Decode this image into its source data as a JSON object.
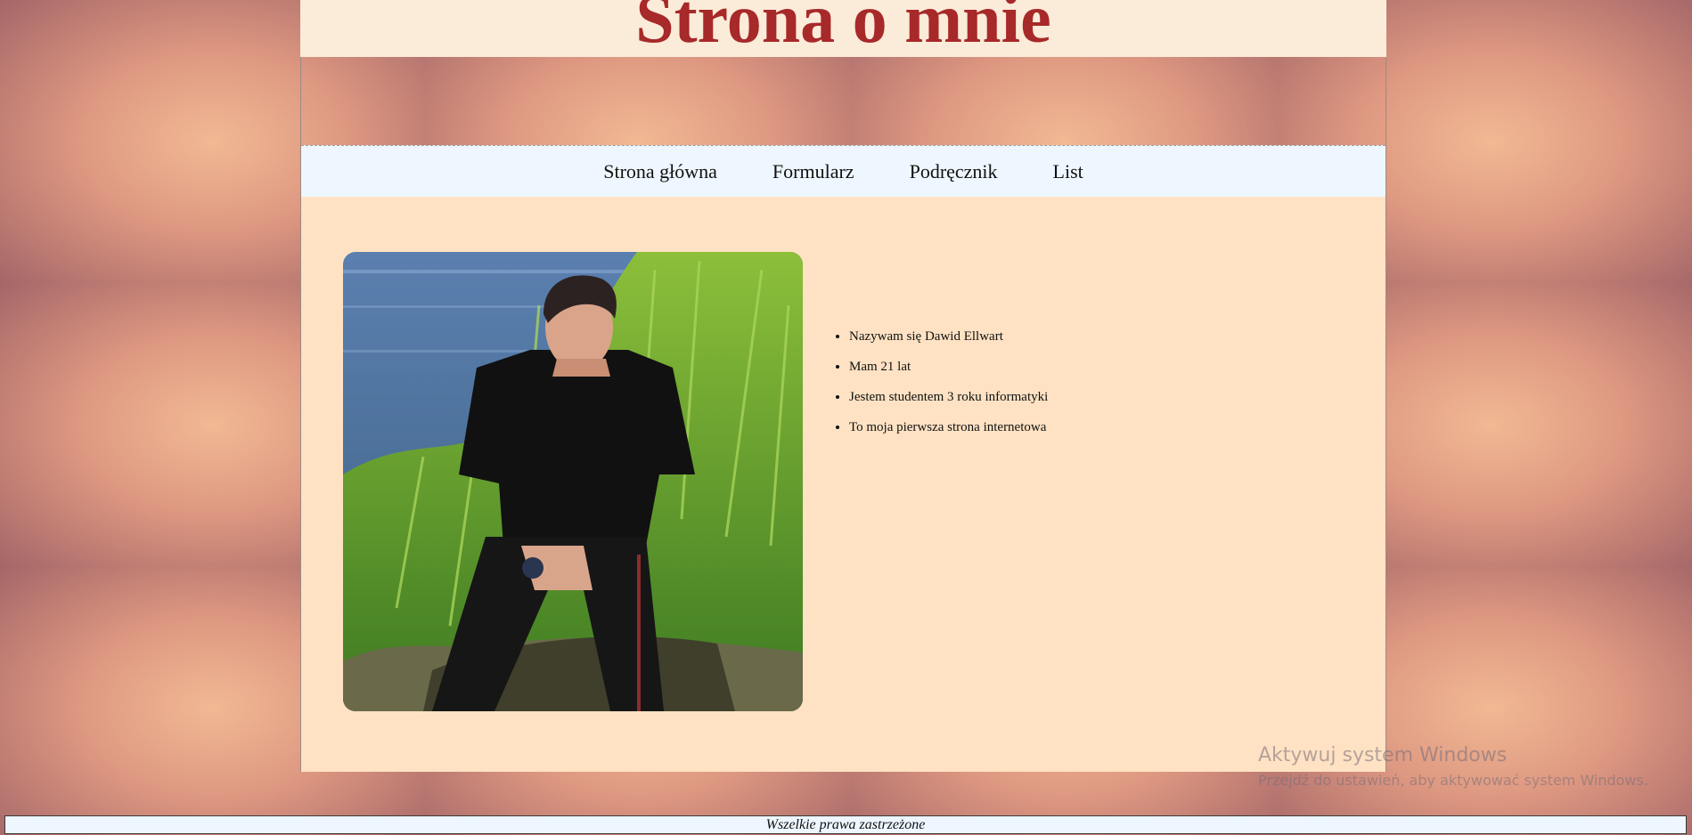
{
  "header": {
    "title": "Strona o mnie"
  },
  "nav": {
    "items": [
      {
        "label": "Strona główna"
      },
      {
        "label": "Formularz"
      },
      {
        "label": "Podręcznik"
      },
      {
        "label": "List"
      }
    ]
  },
  "profile": {
    "photo_alt": "photo of a young man in a black t-shirt sitting by a lake among tall grass",
    "facts": [
      "Nazywam się Dawid Ellwart",
      "Mam 21 lat",
      "Jestem studentem 3 roku informatyki",
      "To moja pierwsza strona internetowa"
    ]
  },
  "footer": {
    "text": "Wszelkie prawa zastrzeżone"
  },
  "overlay": {
    "activation_title": "Aktywuj system Windows",
    "activation_subtitle": "Przejdź do ustawień, aby aktywować system Windows."
  },
  "colors": {
    "title": "#a72929",
    "header_bg": "#fbebd9",
    "nav_bg": "#eef7ff",
    "content_bg": "#fee2c3"
  }
}
